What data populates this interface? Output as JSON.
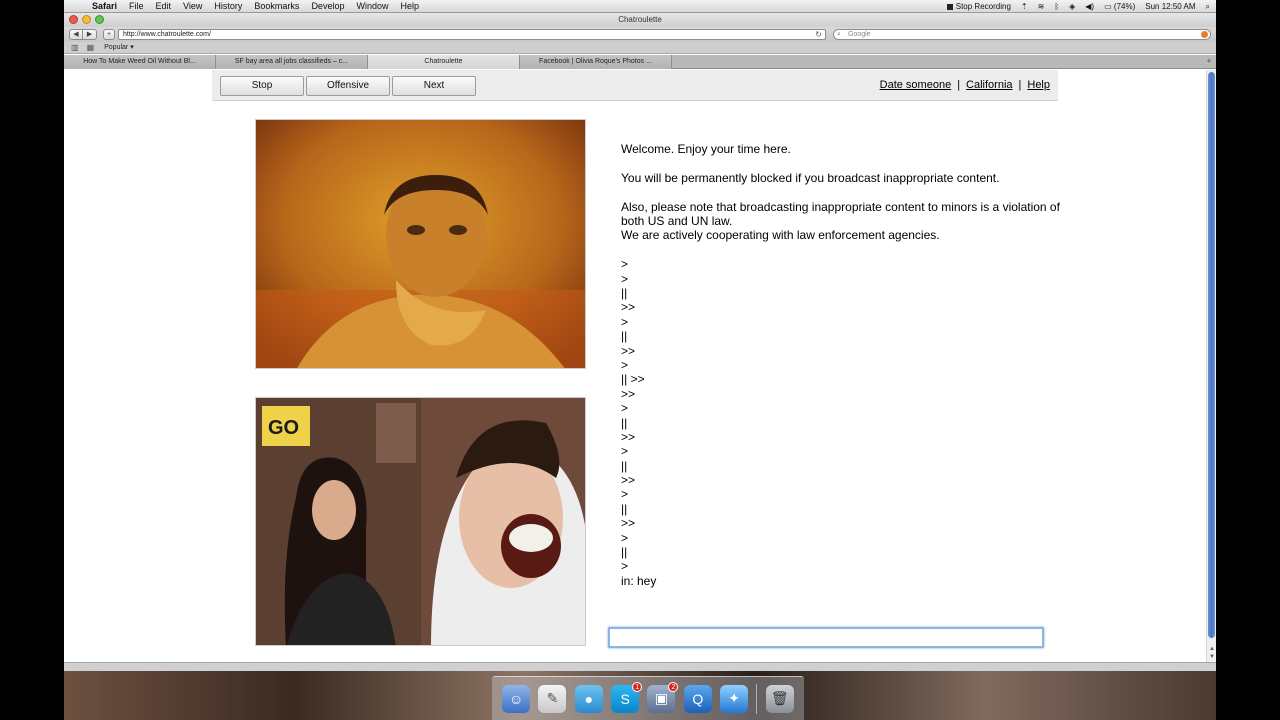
{
  "menubar": {
    "app_name": "Safari",
    "items": [
      "File",
      "Edit",
      "View",
      "History",
      "Bookmarks",
      "Develop",
      "Window",
      "Help"
    ],
    "stop_recording": "Stop Recording",
    "battery": "(74%)",
    "clock": "Sun 12:50 AM"
  },
  "window": {
    "title": "Chatroulette"
  },
  "toolbar": {
    "url": "http://www.chatroulette.com/",
    "search_placeholder": "Google"
  },
  "bookmarks": {
    "popular": "Popular ▾"
  },
  "tabs": [
    {
      "label": "How To Make Weed Oil Without Bl...",
      "active": false
    },
    {
      "label": "SF bay area all jobs classifieds – c...",
      "active": false
    },
    {
      "label": "Chatroulette",
      "active": true
    },
    {
      "label": "Facebook | Olivia Roque's Photos ...",
      "active": false
    }
  ],
  "controls": {
    "stop": "Stop",
    "offensive": "Offensive",
    "next": "Next"
  },
  "links": {
    "date": "Date someone",
    "region": "California",
    "help": "Help",
    "separator": "|"
  },
  "chat": {
    "welcome": "Welcome. Enjoy your time here.",
    "warning": "You will be permanently blocked if you broadcast inappropriate content.",
    "legal_1": "Also, please note that broadcasting inappropriate content to minors is a violation of both US and UN law.",
    "legal_2": "We are actively cooperating with law enforcement agencies.",
    "lines": [
      ">",
      ">",
      "||",
      ">>",
      ">",
      "||",
      ">>",
      ">",
      "|| >>",
      ">>",
      ">",
      "||",
      ">>",
      ">",
      "||",
      ">>",
      ">",
      "||",
      ">>",
      ">",
      "||",
      ">",
      "in: hey"
    ],
    "input_value": ""
  },
  "dock": {
    "skype_badge": "1",
    "preview_badge": "2"
  }
}
